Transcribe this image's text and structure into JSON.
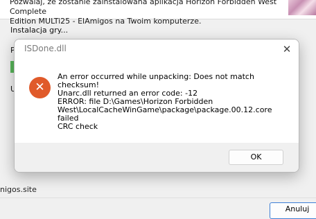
{
  "background_window": {
    "header_line1": "Pozwalaj, że zostanie zainstalowana aplikacja Horizon Forbidden West Complete",
    "header_line2": "Edition MULTi25 - ElAmigos na Twoim komputerze.",
    "install_label": "Instalacja gry...",
    "fragment_p": "P",
    "fragment_u": "U",
    "site_label": "nigos.site",
    "apply_button": "Anuluj",
    "progress_color": "#58b75a"
  },
  "dialog": {
    "title": "ISDone.dll",
    "close_icon": "close-icon",
    "error_icon": "error-icon",
    "error_color": "#e05a2a",
    "message_lines": [
      "An error occurred while unpacking: Does not match",
      "checksum!",
      "Unarc.dll returned an error code: -12",
      "ERROR: file D:\\Games\\Horizon Forbidden",
      "West\\LocalCacheWinGame\\package\\package.00.12.core failed",
      "CRC check"
    ],
    "ok_label": "OK"
  }
}
